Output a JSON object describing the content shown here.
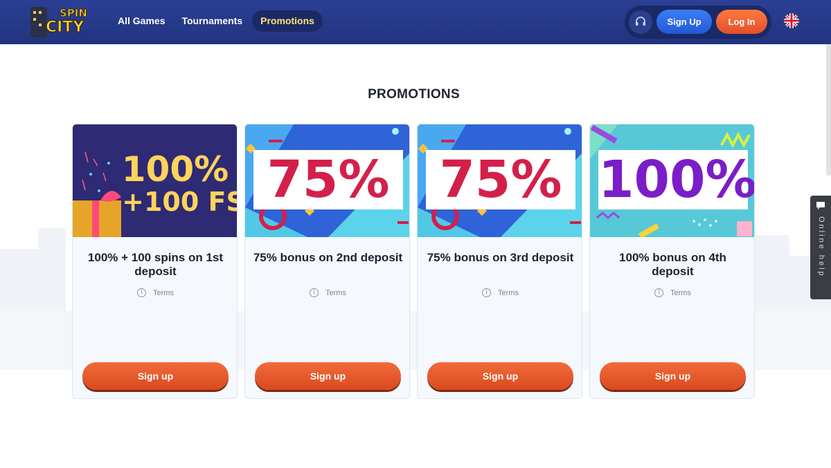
{
  "header": {
    "logo_text_top": "SPIN",
    "logo_text_bottom": "CITY",
    "nav": [
      {
        "label": "All Games"
      },
      {
        "label": "Tournaments"
      },
      {
        "label": "Promotions",
        "active": true
      }
    ],
    "support_icon": "headset-icon",
    "signup_label": "Sign Up",
    "login_label": "Log In",
    "language_icon": "uk-flag-icon"
  },
  "page": {
    "title": "PROMOTIONS"
  },
  "promotions": [
    {
      "banner_line1": "100%",
      "banner_line2": "+100 FS",
      "title": "100% + 100 spins on 1st deposit",
      "terms": "Terms",
      "button": "Sign up"
    },
    {
      "banner": "75%",
      "title": "75% bonus on 2nd deposit",
      "terms": "Terms",
      "button": "Sign up"
    },
    {
      "banner": "75%",
      "title": "75% bonus on 3rd deposit",
      "terms": "Terms",
      "button": "Sign up"
    },
    {
      "banner": "100%",
      "title": "100% bonus on 4th deposit",
      "terms": "Terms",
      "button": "Sign up"
    }
  ],
  "help_tab": {
    "label": "Online help",
    "icon": "chat-bubble-icon"
  },
  "colors": {
    "header_bg": "#2b3f94",
    "accent_orange": "#e4502a",
    "accent_blue": "#2257d6",
    "promo_red": "#d3204a",
    "promo_purple": "#7a1ec8",
    "active_nav_text": "#ffe27a"
  }
}
